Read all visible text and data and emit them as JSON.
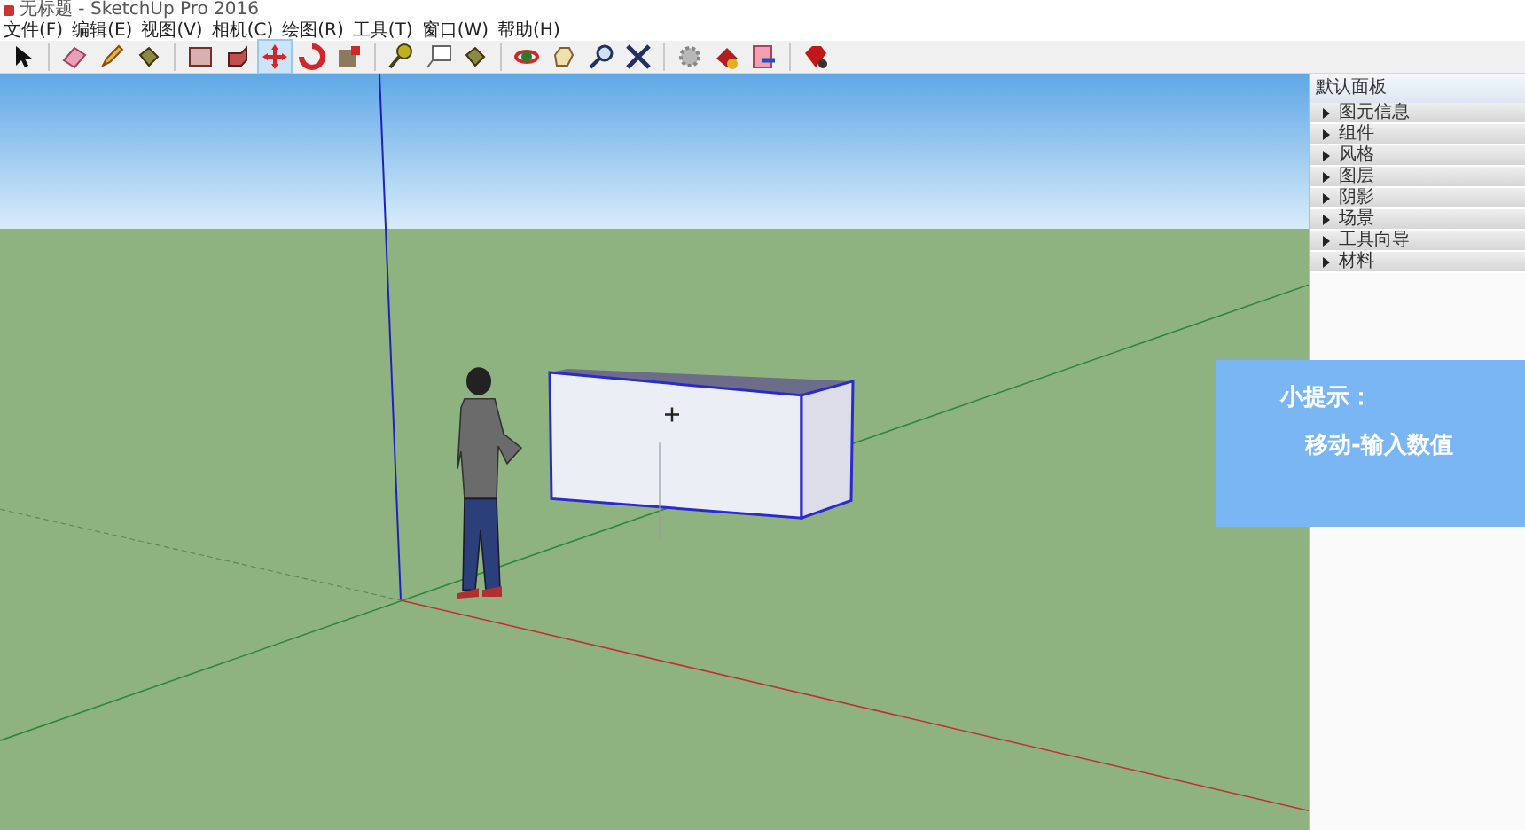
{
  "window": {
    "title": "无标题 - SketchUp Pro 2016"
  },
  "menu": [
    "文件(F)",
    "编辑(E)",
    "视图(V)",
    "相机(C)",
    "绘图(R)",
    "工具(T)",
    "窗口(W)",
    "帮助(H)"
  ],
  "tray": {
    "title": "默认面板",
    "items": [
      {
        "label": "图元信息",
        "expanded": false
      },
      {
        "label": "组件",
        "expanded": false
      },
      {
        "label": "风格",
        "expanded": false
      },
      {
        "label": "图层",
        "expanded": false
      },
      {
        "label": "阴影",
        "expanded": false
      },
      {
        "label": "场景",
        "expanded": false
      },
      {
        "label": "工具向导",
        "expanded": false
      },
      {
        "label": "材料",
        "expanded": false
      }
    ]
  },
  "hint": {
    "title": "小提示：",
    "text": "移动-输入数值"
  }
}
